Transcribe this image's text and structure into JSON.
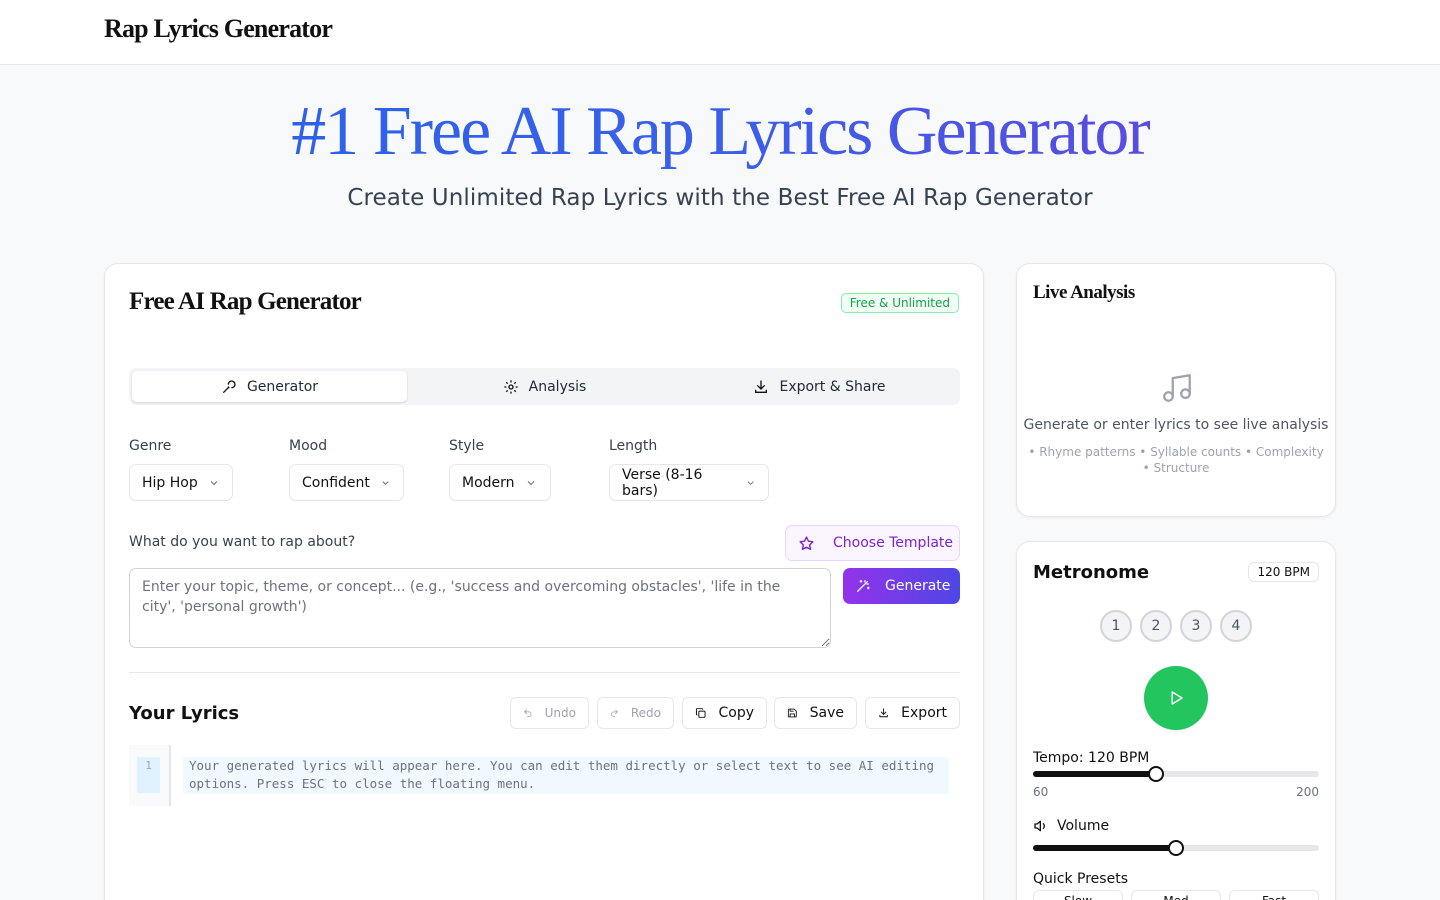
{
  "header": {
    "brand": "Rap Lyrics Generator"
  },
  "hero": {
    "title": "#1 Free AI Rap Lyrics Generator",
    "subtitle": "Create Unlimited Rap Lyrics with the Best Free AI Rap Generator"
  },
  "generator": {
    "title": "Free AI Rap Generator",
    "badge": "Free & Unlimited",
    "tabs": [
      {
        "label": "Generator",
        "icon": "microphone-icon",
        "active": true
      },
      {
        "label": "Analysis",
        "icon": "gear-icon",
        "active": false
      },
      {
        "label": "Export & Share",
        "icon": "download-icon",
        "active": false
      }
    ],
    "fields": [
      {
        "label": "Genre",
        "value": "Hip Hop"
      },
      {
        "label": "Mood",
        "value": "Confident"
      },
      {
        "label": "Style",
        "value": "Modern"
      },
      {
        "label": "Length",
        "value": "Verse (8-16 bars)"
      }
    ],
    "topic_label": "What do you want to rap about?",
    "template_button": "Choose Template",
    "topic_placeholder": "Enter your topic, theme, or concept... (e.g., 'success and overcoming obstacles', 'life in the city', 'personal growth')",
    "generate_button": "Generate"
  },
  "lyrics": {
    "title": "Your Lyrics",
    "undo": "Undo",
    "redo": "Redo",
    "copy": "Copy",
    "save": "Save",
    "export": "Export",
    "line_number": "1",
    "placeholder": "Your generated lyrics will appear here. You can edit them directly or select text to see AI editing options. Press ESC to close the floating menu."
  },
  "analysis": {
    "title": "Live Analysis",
    "icon": "music-note-icon",
    "message": "Generate or enter lyrics to see live analysis",
    "features": "• Rhyme patterns • Syllable counts • Complexity • Structure"
  },
  "metronome": {
    "title": "Metronome",
    "bpm_badge": "120 BPM",
    "beats": [
      "1",
      "2",
      "3",
      "4"
    ],
    "tempo_label": "Tempo: 120 BPM",
    "tempo_min": "60",
    "tempo_max": "200",
    "tempo_value": 120,
    "volume_label": "Volume",
    "volume_fraction": 0.5,
    "presets_label": "Quick Presets",
    "presets": [
      "Slow",
      "Med",
      "Fast"
    ],
    "colors": {
      "play": "#22c55e",
      "accent": "#111111"
    }
  }
}
